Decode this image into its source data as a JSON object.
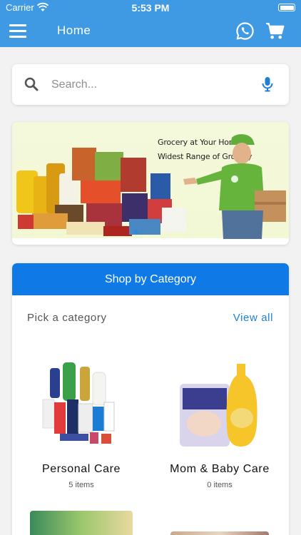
{
  "status_bar": {
    "carrier": "Carrier",
    "time": "5:53 PM"
  },
  "nav": {
    "title": "Home",
    "whatsapp_icon": "whatsapp-icon",
    "cart_icon": "cart-icon",
    "menu_icon": "hamburger-menu-icon"
  },
  "search": {
    "placeholder": "Search...",
    "value": ""
  },
  "banner": {
    "line1": "Grocery at Your Home",
    "line2": "Widest Range of Grocery",
    "slides": 3,
    "active_slide": 1
  },
  "categories": {
    "header": "Shop by Category",
    "pick_label": "Pick a category",
    "view_all": "View all",
    "items": [
      {
        "name": "Personal Care",
        "count": "5 items"
      },
      {
        "name": "Mom & Baby Care",
        "count": "0 items"
      }
    ]
  },
  "colors": {
    "nav_bg": "#3f9ae3",
    "category_header_bg": "#0f7ae5",
    "link": "#1f7fd0"
  }
}
